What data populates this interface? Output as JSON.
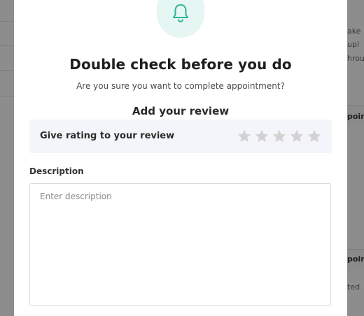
{
  "modal": {
    "title": "Double check before you do",
    "subtitle": "Are you sure you want to complete appointment?",
    "review_heading": "Add your review",
    "rating": {
      "label": "Give rating to your review",
      "value": 0,
      "max": 5
    },
    "description": {
      "label": "Description",
      "placeholder": "Enter description",
      "value": ""
    },
    "icon": "bell-icon",
    "colors": {
      "accent": "#2bb596",
      "icon_bg": "#e6f6f2",
      "star_empty": "#d2d2d2",
      "rating_bg": "#f4f5fa"
    }
  },
  "background": {
    "right_fragments": [
      "ake",
      "upl",
      "hrou",
      "point",
      "point",
      "ted"
    ]
  }
}
